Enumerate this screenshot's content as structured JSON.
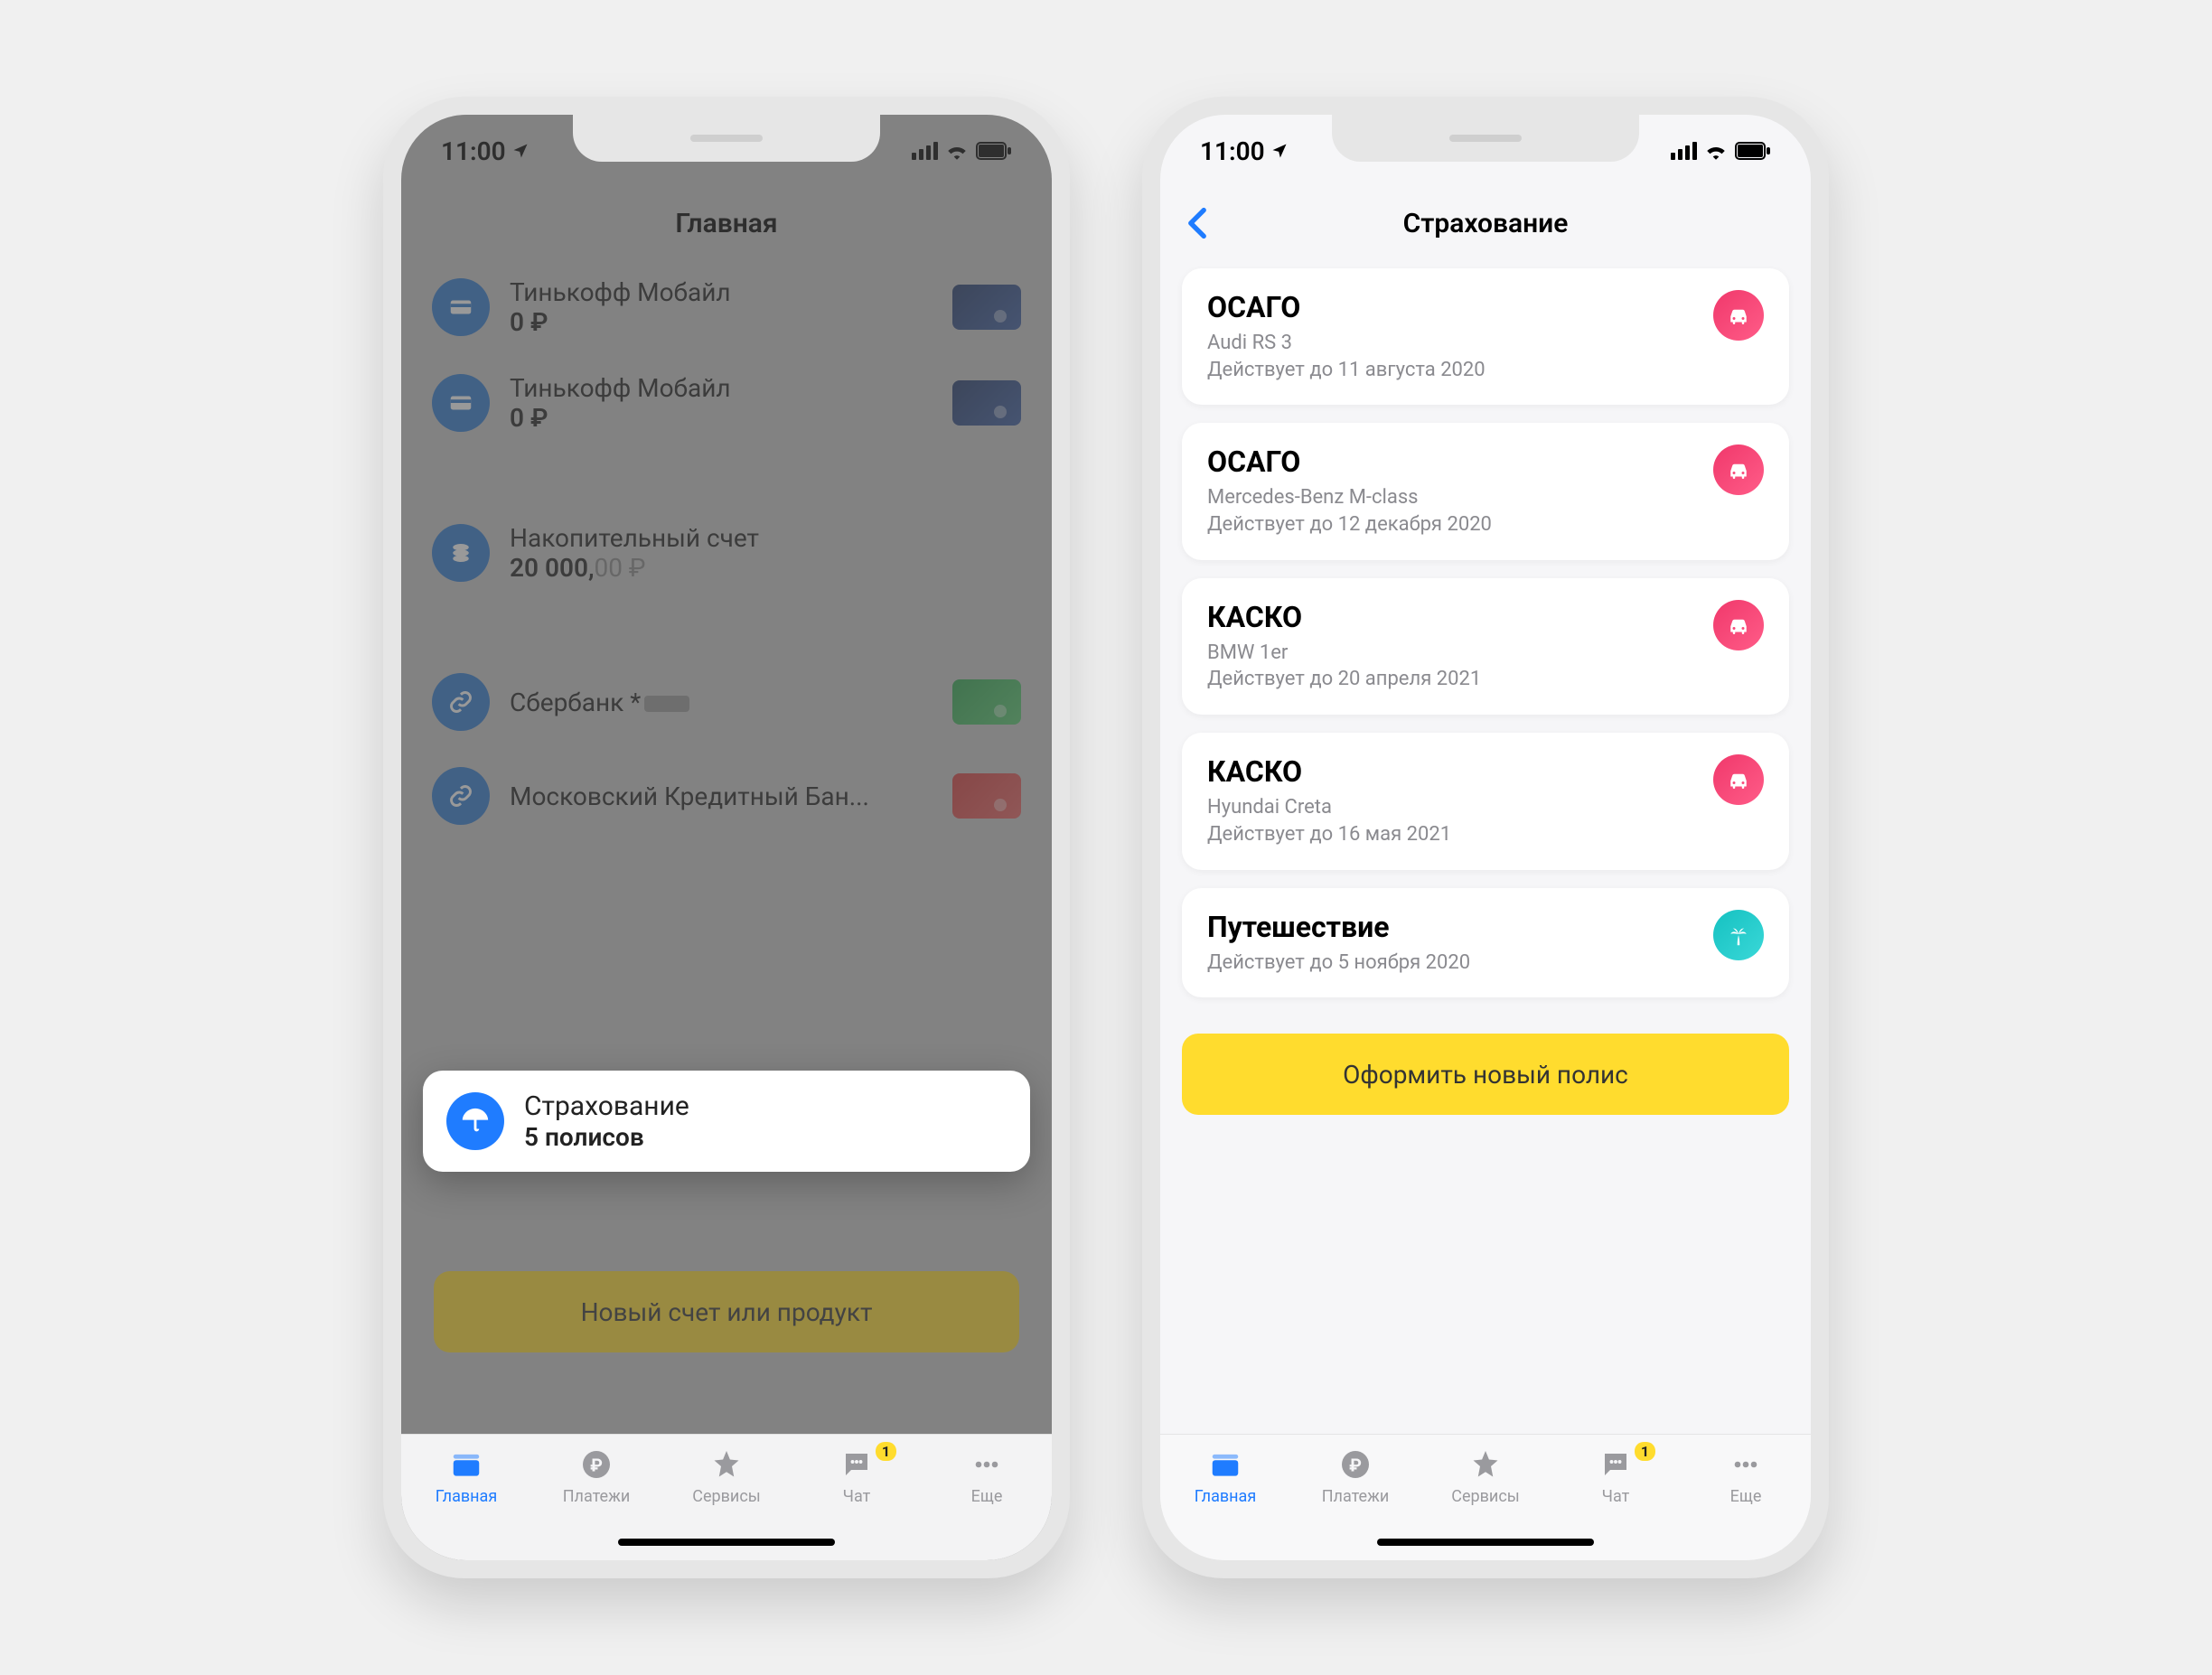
{
  "status": {
    "time": "11:00"
  },
  "left": {
    "title": "Главная",
    "accounts": [
      {
        "name": "Тинькофф Мобайл",
        "amount": "0 ₽",
        "icon": "card",
        "card": "blue"
      },
      {
        "name": "Тинькофф Мобайл",
        "amount": "0 ₽",
        "icon": "card",
        "card": "blue"
      }
    ],
    "savings": {
      "name": "Накопительный счет",
      "amount_main": "20 000,",
      "amount_dec": "00 ₽"
    },
    "external": [
      {
        "name": "Сбербанк *",
        "card": "green"
      },
      {
        "name": "Московский Кредитный Бан...",
        "card": "red"
      }
    ],
    "highlight": {
      "title": "Страхование",
      "subtitle": "5 полисов"
    },
    "cta": "Новый счет или продукт"
  },
  "right": {
    "title": "Страхование",
    "policies": [
      {
        "title": "ОСАГО",
        "line1": "Audi RS 3",
        "line2": "Действует до 11 августа 2020",
        "icon": "car"
      },
      {
        "title": "ОСАГО",
        "line1": "Mercedes-Benz M-class",
        "line2": "Действует до 12 декабря 2020",
        "icon": "car"
      },
      {
        "title": "КАСКО",
        "line1": "BMW 1er",
        "line2": "Действует до 20 апреля 2021",
        "icon": "car"
      },
      {
        "title": "КАСКО",
        "line1": "Hyundai Creta",
        "line2": "Действует до 16 мая 2021",
        "icon": "car"
      },
      {
        "title": "Путешествие",
        "line1": "Действует до 5 ноября 2020",
        "line2": "",
        "icon": "palm"
      }
    ],
    "cta": "Оформить новый полис"
  },
  "tabs": {
    "items": [
      {
        "label": "Главная"
      },
      {
        "label": "Платежи"
      },
      {
        "label": "Сервисы"
      },
      {
        "label": "Чат",
        "badge": "1"
      },
      {
        "label": "Еще"
      }
    ]
  }
}
